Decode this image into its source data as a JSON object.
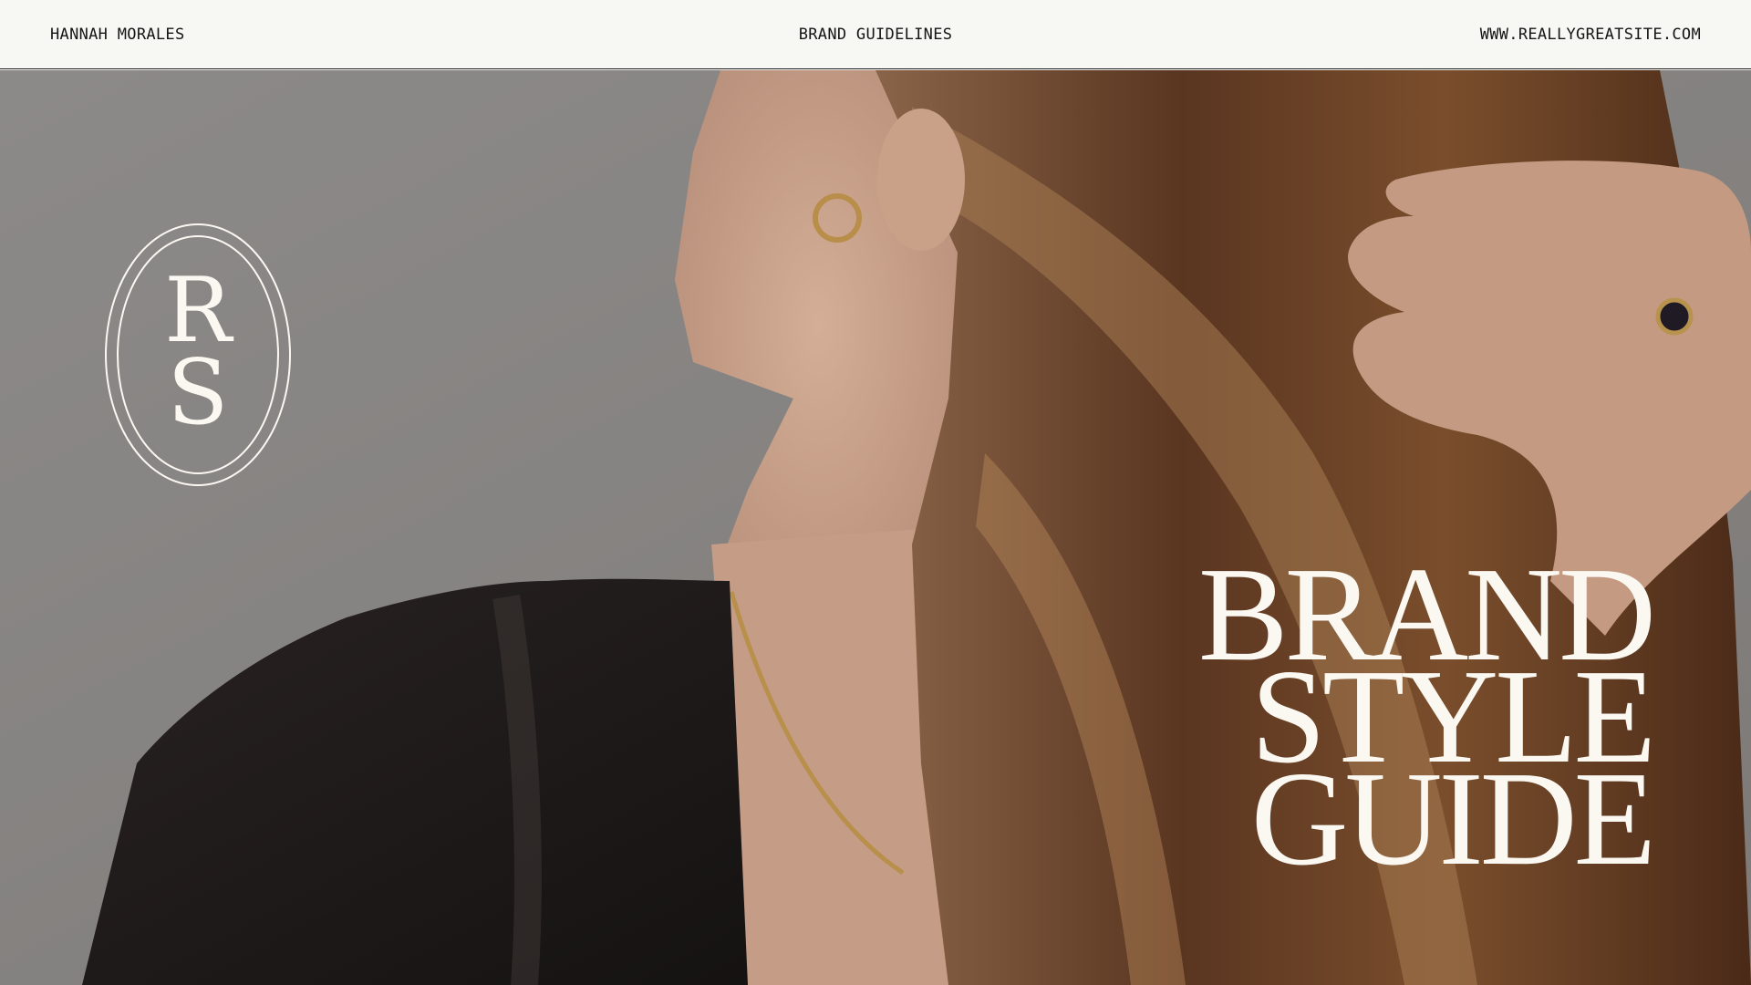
{
  "header": {
    "left_text": "HANNAH MORALES",
    "center_text": "BRAND GUIDELINES",
    "right_text": "WWW.REALLYGREATSITE.COM"
  },
  "monogram": {
    "letter_top": "R",
    "letter_bottom": "S"
  },
  "title": {
    "line1": "BRAND",
    "line2": "STYLE",
    "line3": "GUIDE"
  },
  "colors": {
    "header_bg": "#f7f7f3",
    "header_text": "#151515",
    "overlay_text": "#fbf8f2",
    "wall_gray": "#8f8d8b",
    "hair_brown": "#6b4428",
    "garment_black": "#1e1a19",
    "skin": "#c49a82"
  }
}
